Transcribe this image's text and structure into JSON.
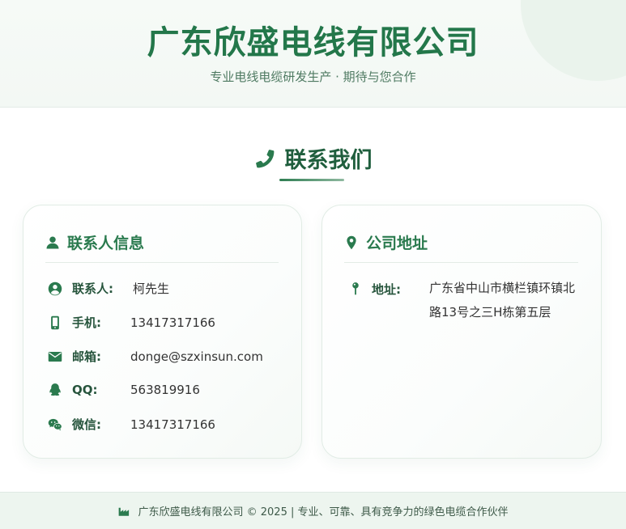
{
  "header": {
    "title": "广东欣盛电线有限公司",
    "subtitle": "专业电线电缆研发生产 · 期待与您合作"
  },
  "section": {
    "title": "联系我们",
    "icon": "phone-icon"
  },
  "contact_card": {
    "heading": "联系人信息",
    "rows": [
      {
        "label": "联系人:",
        "value": "柯先生",
        "icon": "user-circle-icon"
      },
      {
        "label": "手机:",
        "value": "13417317166",
        "icon": "mobile-icon"
      },
      {
        "label": "邮箱:",
        "value": "donge@szxinsun.com",
        "icon": "envelope-icon"
      },
      {
        "label": "QQ:",
        "value": "563819916",
        "icon": "qq-icon"
      },
      {
        "label": "微信:",
        "value": "13417317166",
        "icon": "wechat-icon"
      }
    ]
  },
  "address_card": {
    "heading": "公司地址",
    "label": "地址:",
    "value": "广东省中山市横栏镇环镇北路13号之三H栋第五层"
  },
  "footer": {
    "text": "广东欣盛电线有限公司 © 2025 | 专业、可靠、具有竞争力的绿色电缆合作伙伴"
  },
  "colors": {
    "brand_green": "#23774a",
    "dark_green": "#1f5e3d",
    "footer_bg": "#edf5ef"
  }
}
